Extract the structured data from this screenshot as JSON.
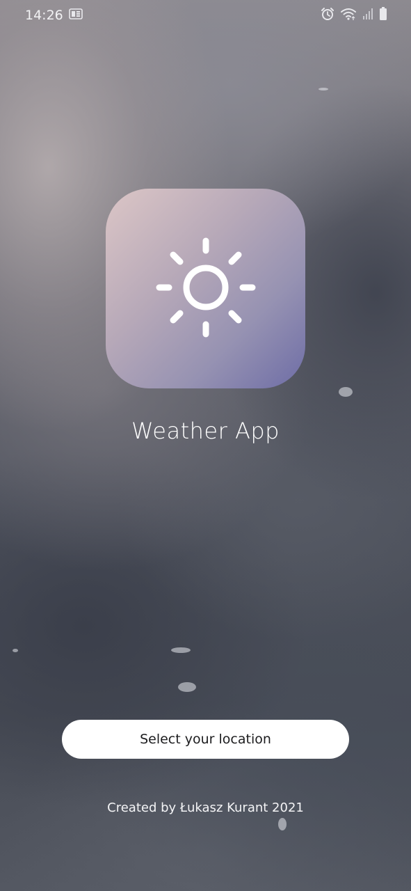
{
  "status_bar": {
    "time": "14:26",
    "icons": [
      "notification-icon",
      "alarm-icon",
      "wifi-icon",
      "signal-icon",
      "battery-icon"
    ]
  },
  "app": {
    "title": "Weather App",
    "icon": "sun-icon"
  },
  "actions": {
    "select_location_label": "Select your location"
  },
  "footer": {
    "credit": "Created by Łukasz Kurant 2021"
  }
}
